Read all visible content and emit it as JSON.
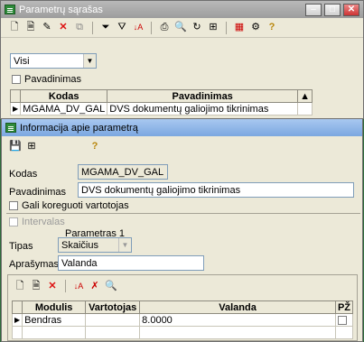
{
  "list_window": {
    "title": "Parametrų sąrašas",
    "filter_value": "Visi",
    "names_checkbox_label": "Pavadinimas",
    "columns": [
      "Kodas",
      "Pavadinimas"
    ],
    "rows": [
      {
        "kodas": "MGAMA_DV_GAL",
        "pavadinimas": "DVS dokumentų galiojimo tikrinimas"
      }
    ]
  },
  "detail_window": {
    "title": "Informacija apie parametrą",
    "kodas_label": "Kodas",
    "kodas_value": "MGAMA_DV_GAL",
    "pavadinimas_label": "Pavadinimas",
    "pavadinimas_value": "DVS dokumentų galiojimo tikrinimas",
    "can_edit_label": "Gali koreguoti vartotojas",
    "intervals_label": "Intervalas",
    "param_header": "Parametras 1",
    "tipas_label": "Tipas",
    "tipas_value": "Skaičius",
    "aprasymas_label": "Aprašymas",
    "aprasymas_value": "Valanda",
    "grid_columns": [
      "Modulis",
      "Vartotojas",
      "Valanda",
      "PŽ"
    ],
    "grid_rows": [
      {
        "modulis": "Bendras",
        "vartotojas": "",
        "valanda": "8.0000"
      }
    ]
  },
  "icons": {
    "new": "new-doc-icon",
    "open": "open-doc-icon",
    "delete": "delete-icon",
    "copy": "copy-icon",
    "filter": "filter-icon",
    "sort": "sort-icon",
    "print": "print-icon",
    "find": "find-icon",
    "help": "help-icon",
    "save": "save-icon"
  },
  "colors": {
    "title_active": "#7ba7e0",
    "title_inactive": "#9d9d9d",
    "desktop": "#2f6b3a",
    "delete": "#d11"
  }
}
